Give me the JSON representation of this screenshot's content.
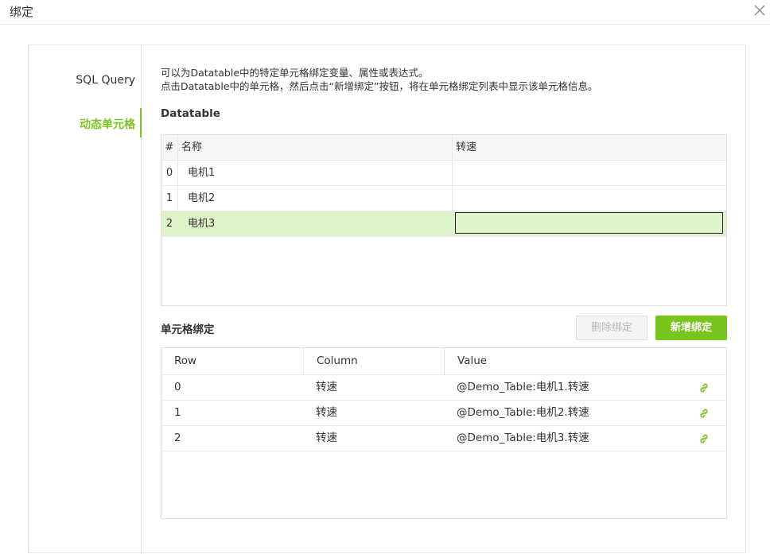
{
  "header": {
    "title": "绑定"
  },
  "nav": {
    "items": [
      {
        "label": "SQL Query"
      },
      {
        "label": "动态单元格"
      }
    ]
  },
  "description": {
    "line1": "可以为Datatable中的特定单元格绑定变量、属性或表达式。",
    "line2": "点击Datatable中的单元格，然后点击“新增绑定”按钮，将在单元格绑定列表中显示该单元格信息。"
  },
  "datatable": {
    "title": "Datatable",
    "columns": [
      "#",
      "名称",
      "转速"
    ],
    "rows": [
      {
        "index": "0",
        "name": "电机1",
        "speed": ""
      },
      {
        "index": "1",
        "name": "电机2",
        "speed": ""
      },
      {
        "index": "2",
        "name": "电机3",
        "speed": ""
      }
    ]
  },
  "binding": {
    "title": "单元格绑定",
    "delete_label": "删除绑定",
    "add_label": "新增绑定",
    "columns": [
      "Row",
      "Column",
      "Value"
    ],
    "rows": [
      {
        "row": "0",
        "column": "转速",
        "value": "@Demo_Table:电机1.转速"
      },
      {
        "row": "1",
        "column": "转速",
        "value": "@Demo_Table:电机2.转速"
      },
      {
        "row": "2",
        "column": "转速",
        "value": "@Demo_Table:电机3.转速"
      }
    ]
  },
  "colors": {
    "accent": "#76c41c",
    "selected_row": "#ddf3c9"
  },
  "icons": {
    "close": "close-icon",
    "link": "link-icon"
  }
}
